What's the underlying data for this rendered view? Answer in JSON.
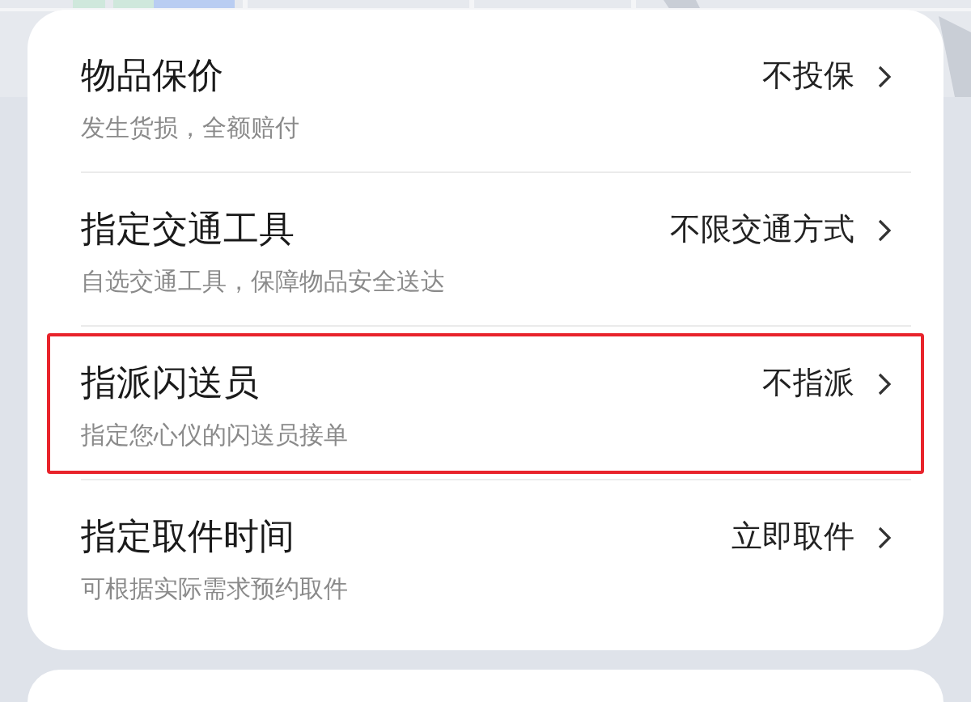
{
  "options": [
    {
      "title": "物品保价",
      "subtitle": "发生货损，全额赔付",
      "value": "不投保",
      "highlighted": false
    },
    {
      "title": "指定交通工具",
      "subtitle": "自选交通工具，保障物品安全送达",
      "value": "不限交通方式",
      "highlighted": false
    },
    {
      "title": "指派闪送员",
      "subtitle": "指定您心仪的闪送员接单",
      "value": "不指派",
      "highlighted": true
    },
    {
      "title": "指定取件时间",
      "subtitle": "可根据实际需求预约取件",
      "value": "立即取件",
      "highlighted": false
    }
  ]
}
